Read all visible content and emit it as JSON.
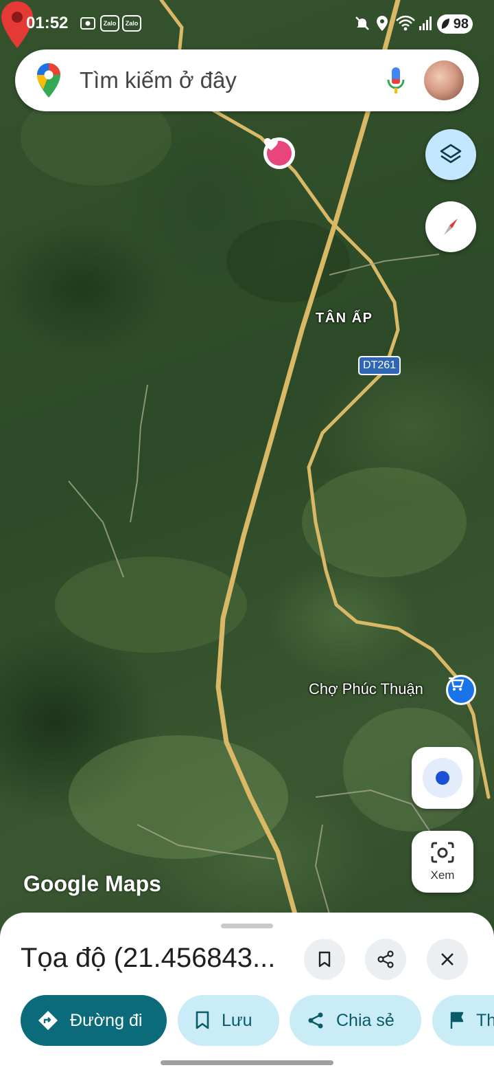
{
  "status_bar": {
    "time": "01:52",
    "zalo_1": "Zalo",
    "zalo_2": "Zalo",
    "battery": "98"
  },
  "search": {
    "placeholder": "Tìm kiếm ở đây"
  },
  "map": {
    "town_label": "TÂN ẤP",
    "road_shield": "DT261",
    "poi_label": "Chợ Phúc Thuận",
    "watermark": "Google Maps"
  },
  "controls": {
    "lens_label": "Xem"
  },
  "sheet": {
    "title": "Tọa độ (21.456843...",
    "chips": {
      "directions": "Đường đi",
      "save": "Lưu",
      "share": "Chia sẻ",
      "label": "Th"
    }
  },
  "colors": {
    "primary_chip": "#0b6b7a",
    "secondary_chip": "#c9ecf6",
    "layers_button": "#c2e7ff",
    "pin_red": "#e53935",
    "road_yellow": "#d9b866"
  }
}
